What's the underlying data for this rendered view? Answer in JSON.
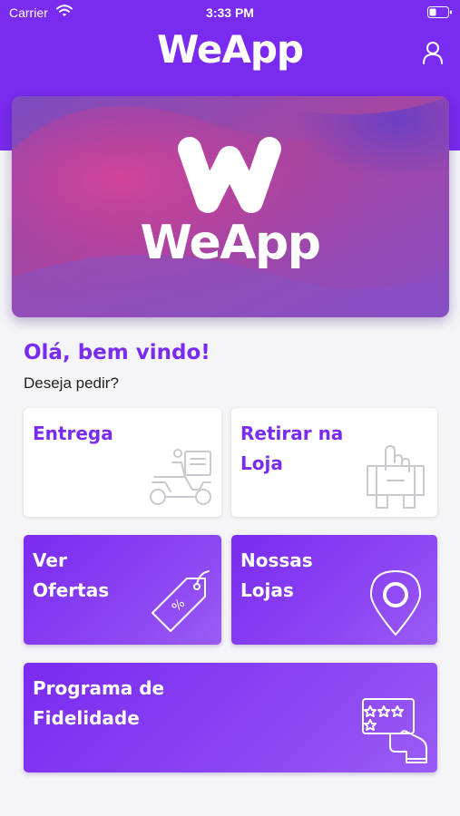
{
  "status_bar": {
    "carrier": "Carrier",
    "time": "3:33 PM"
  },
  "header": {
    "title": "WeApp"
  },
  "banner": {
    "logo_text": "WeApp"
  },
  "welcome": {
    "title": "Olá, bem vindo!",
    "subtitle": "Deseja pedir?"
  },
  "options": {
    "entrega": {
      "label": "Entrega"
    },
    "retirar": {
      "label_line1": "Retirar na",
      "label_line2": "Loja"
    },
    "ofertas": {
      "label_line1": "Ver",
      "label_line2": "Ofertas",
      "badge": "%"
    },
    "lojas": {
      "label_line1": "Nossas",
      "label_line2": "Lojas"
    },
    "fidelidade": {
      "label_line1": "Programa de",
      "label_line2": "Fidelidade"
    }
  },
  "icons": {
    "wifi": "wifi-icon",
    "battery": "battery-icon",
    "profile": "user-icon",
    "entrega": "delivery-scooter-icon",
    "retirar": "store-pickup-icon",
    "ofertas": "price-tag-icon",
    "lojas": "map-pin-icon",
    "fidelidade": "loyalty-card-icon"
  },
  "colors": {
    "primary": "#7a2bf0",
    "background": "#f5f5f7",
    "card": "#ffffff"
  }
}
